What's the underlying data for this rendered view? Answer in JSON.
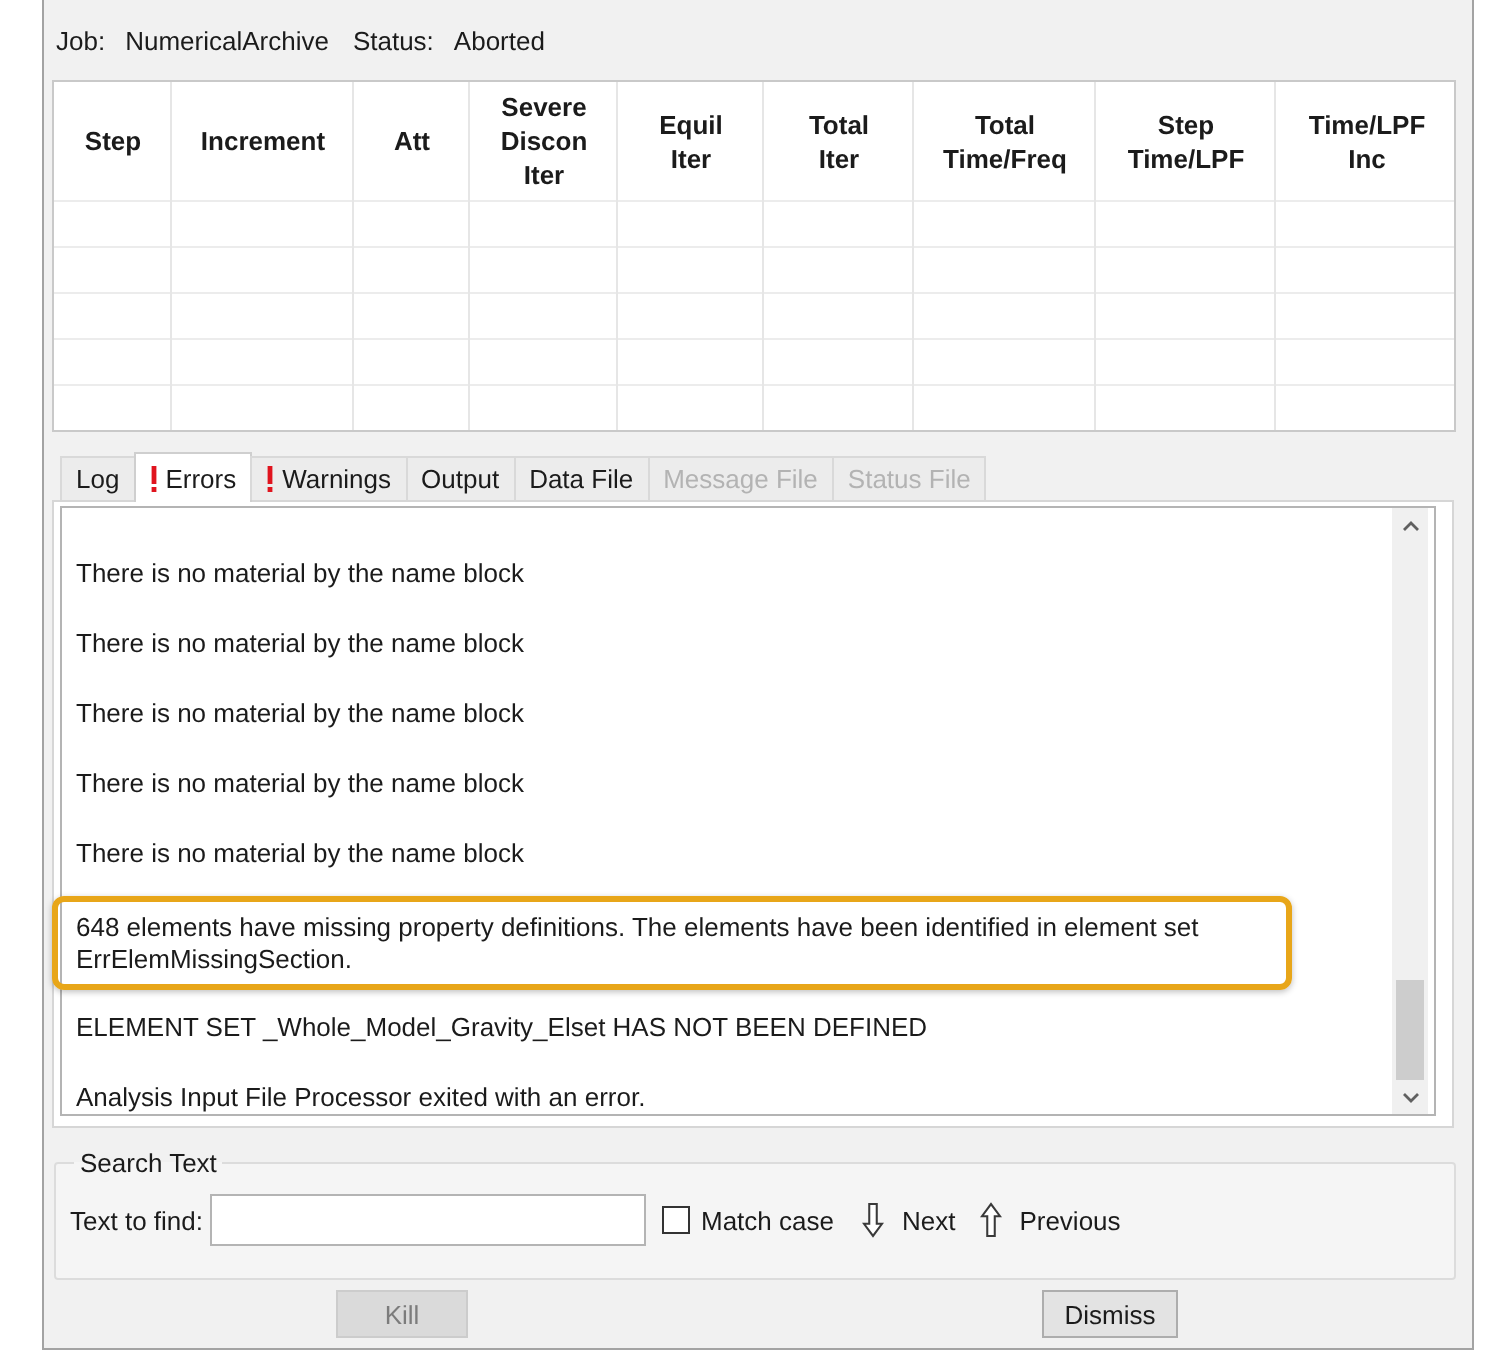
{
  "job": {
    "label": "Job:",
    "name": "NumericalArchive",
    "status_label": "Status:",
    "status": "Aborted"
  },
  "table": {
    "columns": [
      "Step",
      "Increment",
      "Att",
      "Severe\nDiscon\nIter",
      "Equil\nIter",
      "Total\nIter",
      "Total\nTime/Freq",
      "Step\nTime/LPF",
      "Time/LPF\nInc"
    ]
  },
  "tabs": [
    {
      "label": "Log",
      "alert": false,
      "selected": false,
      "disabled": false
    },
    {
      "label": "Errors",
      "alert": true,
      "selected": true,
      "disabled": false
    },
    {
      "label": "Warnings",
      "alert": true,
      "selected": false,
      "disabled": false
    },
    {
      "label": "Output",
      "alert": false,
      "selected": false,
      "disabled": false
    },
    {
      "label": "Data File",
      "alert": false,
      "selected": false,
      "disabled": false
    },
    {
      "label": "Message File",
      "alert": false,
      "selected": false,
      "disabled": true
    },
    {
      "label": "Status File",
      "alert": false,
      "selected": false,
      "disabled": true
    }
  ],
  "messages": [
    {
      "text": "There is no material by the name block",
      "highlighted": false
    },
    {
      "text": "There is no material by the name block",
      "highlighted": false
    },
    {
      "text": "There is no material by the name block",
      "highlighted": false
    },
    {
      "text": "There is no material by the name block",
      "highlighted": false
    },
    {
      "text": "There is no material by the name block",
      "highlighted": false
    },
    {
      "text": "648 elements have missing property definitions. The elements have been identified in element set ErrElemMissingSection.",
      "highlighted": true
    },
    {
      "text": "ELEMENT SET _Whole_Model_Gravity_Elset HAS NOT BEEN DEFINED",
      "highlighted": false
    },
    {
      "text": "Analysis Input File Processor exited with an error.",
      "highlighted": false
    }
  ],
  "search": {
    "title": "Search Text",
    "field_label": "Text to find:",
    "match_case": {
      "label": "Match case",
      "checked": false
    },
    "next": "Next",
    "previous": "Previous"
  },
  "buttons": [
    {
      "label": "Kill",
      "disabled": true
    },
    {
      "label": "Dismiss",
      "disabled": false
    }
  ]
}
